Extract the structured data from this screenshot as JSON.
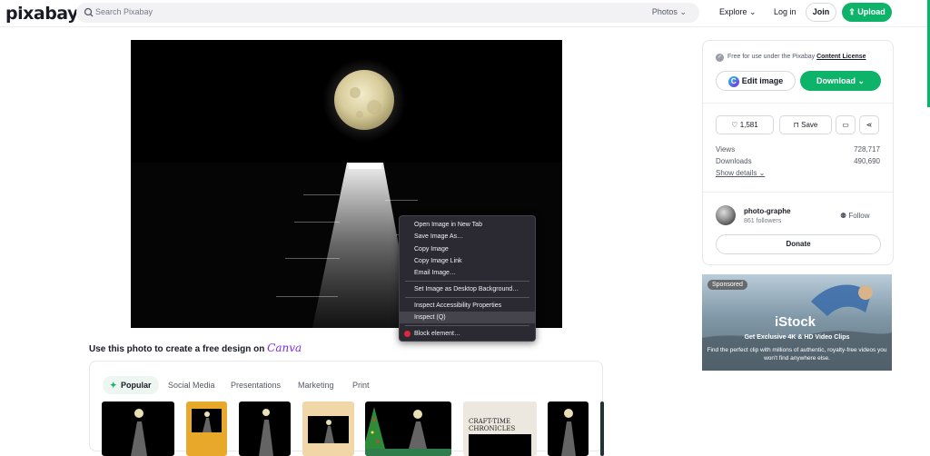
{
  "header": {
    "logo": "pixabay",
    "search_placeholder": "Search Pixabay",
    "search_type": "Photos",
    "explore": "Explore",
    "login": "Log in",
    "join": "Join",
    "upload": "Upload"
  },
  "canva": {
    "prompt": "Use this photo to create a free design on",
    "brand": "Canva",
    "tabs": [
      "Popular",
      "Social Media",
      "Presentations",
      "Marketing",
      "Print"
    ],
    "thumb_text": "CRAFT-TIME CHRONICLES"
  },
  "sidebar": {
    "license_text": "Free for use under the Pixabay",
    "license_link": "Content License",
    "edit_image": "Edit image",
    "download": "Download",
    "likes": "1,581",
    "save": "Save",
    "views_label": "Views",
    "views_value": "728,717",
    "downloads_label": "Downloads",
    "downloads_value": "490,690",
    "show_details": "Show details",
    "username": "photo-graphe",
    "followers": "861 followers",
    "follow": "Follow",
    "donate": "Donate"
  },
  "ad": {
    "sponsored": "Sponsored",
    "logo": "iStock",
    "headline": "Get Exclusive 4K & HD Video Clips",
    "body": "Find the perfect clip with millions of authentic, royalty-free videos you won't find anywhere else."
  },
  "context_menu": {
    "items": [
      "Open Image in New Tab",
      "Save Image As…",
      "Copy Image",
      "Copy Image Link",
      "Email Image…",
      "Set Image as Desktop Background…",
      "Inspect Accessibility Properties",
      "Inspect (Q)",
      "Block element…"
    ]
  },
  "colors": {
    "brand_green": "#0eb36a",
    "canva_purple": "#7d2ae8",
    "menu_bg": "#2b2a33"
  }
}
